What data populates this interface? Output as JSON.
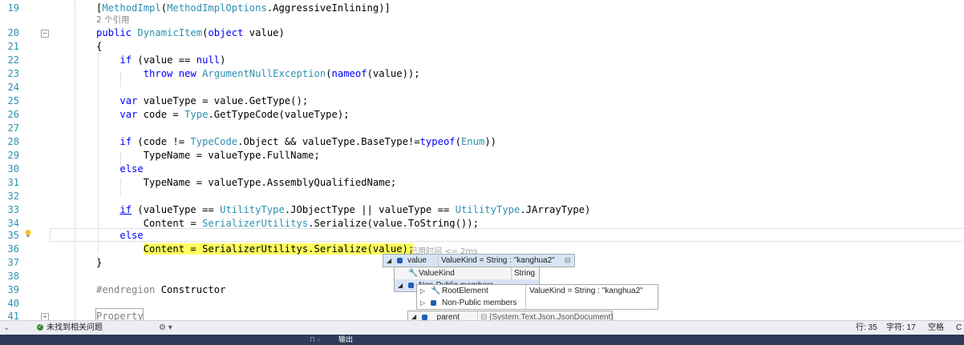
{
  "editor": {
    "codelens": "2 个引用",
    "elapsed": "已用时间 <= 2ms",
    "lines": {
      "l19": "19",
      "l20": "20",
      "l21": "21",
      "l22": "22",
      "l23": "23",
      "l24": "24",
      "l25": "25",
      "l26": "26",
      "l27": "27",
      "l28": "28",
      "l29": "29",
      "l30": "30",
      "l31": "31",
      "l32": "32",
      "l33": "33",
      "l34": "34",
      "l35": "35",
      "l36": "36",
      "l37": "37",
      "l38": "38",
      "l39": "39",
      "l40": "40",
      "l41": "41"
    }
  },
  "datatip": {
    "root_name": "value",
    "root_value": "ValueKind = String : \"kanghua2\"",
    "valuekind_name": "ValueKind",
    "valuekind_value": "String",
    "nonpublic_label": "Non-Public members",
    "sub_root_element": "RootElement",
    "sub_root_value": "ValueKind = String : \"kanghua2\"",
    "sub_nonpublic": "Non-Public members",
    "parent_name": "_parent",
    "parent_value": "{System.Text.Json.JsonDocument}"
  },
  "status": {
    "issues": "未找到相关问题",
    "line": "行: 35",
    "char": "字符: 17",
    "space": "空格",
    "trail": "C"
  },
  "taskbar": {
    "label": "输出"
  }
}
